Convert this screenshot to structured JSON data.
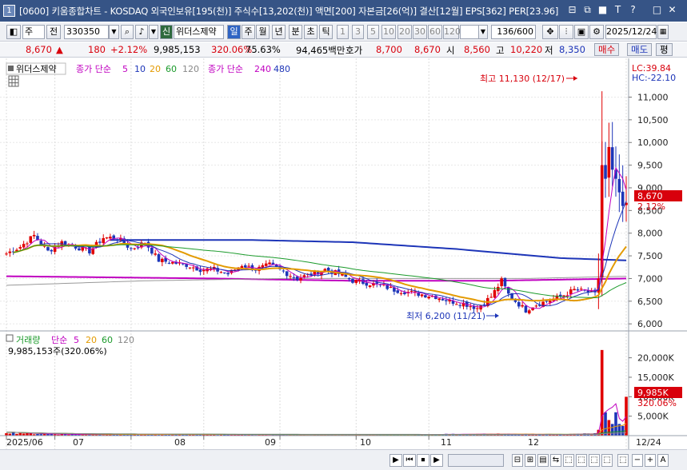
{
  "window": {
    "number": "1",
    "title": "[0600] 키움종합차트 - KOSDAQ 외국인보유[195(천)] 주식수[13,202(천)] 액면[200] 자본금[26(억)] 결산[12월] EPS[362] PER[23.96]",
    "controls": [
      "⊟",
      "⧉",
      "■",
      "T",
      "?",
      "□",
      "✕"
    ]
  },
  "toolbar": {
    "period": "주",
    "adj": "전",
    "code": "330350",
    "name": "위더스제약",
    "credit_tag": "신",
    "period_tabs": [
      "일",
      "주",
      "월",
      "년",
      "분",
      "초",
      "틱"
    ],
    "active_tab": "일",
    "minute_steps": [
      "1",
      "3",
      "5",
      "10",
      "20",
      "30",
      "60",
      "120"
    ],
    "count": "136/600",
    "date": "2025/12/24"
  },
  "quote": {
    "price": "8,670",
    "arrow": "▲",
    "change": "180",
    "rate": "+2.12%",
    "volume": "9,985,153",
    "vol_ratio": "320.06%",
    "turnover": "75.63%",
    "amount": "94,465백만",
    "hoga_label": "호가",
    "ask": "8,700",
    "bid": "8,670",
    "open_label": "시",
    "open": "8,560",
    "high_label": "고",
    "high": "10,220",
    "low_label": "저",
    "low": "8,350",
    "buy": "매수",
    "sell": "매도",
    "eval": "평"
  },
  "price_pane": {
    "stock": "위더스제약",
    "legend1": "종가 단순",
    "ma_short": [
      "5",
      "10",
      "20",
      "60",
      "120"
    ],
    "legend2": "종가 단순",
    "ma_long": [
      "240",
      "480"
    ],
    "lc": "LC:39.84",
    "hc": "HC:-22.10",
    "high_note": "최고 11,130 (12/17)",
    "low_note": "최저 6,200 (11/21)",
    "last_price": "8,670",
    "last_rate": "2.12%"
  },
  "volume_pane": {
    "title": "거래량",
    "legend": "단순",
    "periods": [
      "5",
      "20",
      "60",
      "120"
    ],
    "current": "9,985,153주(320.06%)",
    "tag_value": "9,985K",
    "tag_rate": "320.06%"
  },
  "chart_data": {
    "type": "candlestick",
    "x_axis": [
      "2025/06",
      "07",
      "08",
      "09",
      "10",
      "11",
      "12",
      "12/24"
    ],
    "price_ticks": [
      "11,000",
      "10,500",
      "10,000",
      "9,500",
      "9,000",
      "8,500",
      "8,000",
      "7,500",
      "7,000",
      "6,500",
      "6,000"
    ],
    "ylim": [
      5950,
      11150
    ],
    "volume_ticks": [
      "20,000K",
      "15,000K",
      "10,000K",
      "5,000K"
    ],
    "close_anchors": [
      [
        0,
        7550
      ],
      [
        4,
        7700
      ],
      [
        8,
        7950
      ],
      [
        12,
        7600
      ],
      [
        16,
        7800
      ],
      [
        20,
        7700
      ],
      [
        24,
        7600
      ],
      [
        28,
        7900
      ],
      [
        32,
        7900
      ],
      [
        36,
        7650
      ],
      [
        40,
        7800
      ],
      [
        44,
        7400
      ],
      [
        48,
        7350
      ],
      [
        52,
        7300
      ],
      [
        56,
        7200
      ],
      [
        60,
        7200
      ],
      [
        64,
        7100
      ],
      [
        68,
        7300
      ],
      [
        72,
        7200
      ],
      [
        76,
        7300
      ],
      [
        80,
        7150
      ],
      [
        84,
        7000
      ],
      [
        88,
        7100
      ],
      [
        92,
        7200
      ],
      [
        96,
        7100
      ],
      [
        100,
        6950
      ],
      [
        104,
        6900
      ],
      [
        108,
        6850
      ],
      [
        112,
        6750
      ],
      [
        116,
        6700
      ],
      [
        120,
        6650
      ],
      [
        124,
        6600
      ],
      [
        128,
        6500
      ],
      [
        132,
        6450
      ],
      [
        136,
        6350
      ],
      [
        140,
        6600
      ],
      [
        143,
        6950
      ],
      [
        145,
        6650
      ],
      [
        147,
        6500
      ],
      [
        150,
        6300
      ],
      [
        152,
        6400
      ],
      [
        156,
        6500
      ],
      [
        160,
        6600
      ],
      [
        164,
        6750
      ],
      [
        168,
        6700
      ],
      [
        170,
        6650
      ],
      [
        171,
        7000
      ],
      [
        172,
        9500
      ],
      [
        173,
        9200
      ],
      [
        174,
        9900
      ],
      [
        175,
        9400
      ],
      [
        176,
        9200
      ],
      [
        177,
        8900
      ],
      [
        178,
        8600
      ],
      [
        179,
        8670
      ]
    ],
    "ma240": [
      [
        0,
        7050
      ],
      [
        60,
        7000
      ],
      [
        100,
        6950
      ],
      [
        140,
        6950
      ],
      [
        179,
        7000
      ]
    ],
    "ma120": [
      [
        0,
        6850
      ],
      [
        40,
        6950
      ],
      [
        80,
        7000
      ],
      [
        110,
        7000
      ],
      [
        150,
        7000
      ],
      [
        179,
        7050
      ]
    ],
    "ma480": [
      [
        30,
        7850
      ],
      [
        70,
        7850
      ],
      [
        100,
        7800
      ],
      [
        130,
        7650
      ],
      [
        160,
        7450
      ],
      [
        179,
        7400
      ]
    ],
    "volume_anchors": [
      [
        0,
        900
      ],
      [
        4,
        700
      ],
      [
        8,
        500
      ],
      [
        20,
        300
      ],
      [
        40,
        300
      ],
      [
        60,
        300
      ],
      [
        80,
        250
      ],
      [
        100,
        250
      ],
      [
        120,
        300
      ],
      [
        140,
        400
      ],
      [
        160,
        300
      ],
      [
        170,
        500
      ],
      [
        171,
        1500
      ],
      [
        172,
        22000
      ],
      [
        173,
        6000
      ],
      [
        174,
        4000
      ],
      [
        175,
        3000
      ],
      [
        176,
        6000
      ],
      [
        177,
        3000
      ],
      [
        178,
        2500
      ],
      [
        179,
        9985
      ]
    ]
  },
  "bottom": {
    "buttons": [
      "▶",
      "⏮",
      "⏹",
      "▶"
    ],
    "zoom": [
      "−",
      "+",
      "A"
    ]
  }
}
